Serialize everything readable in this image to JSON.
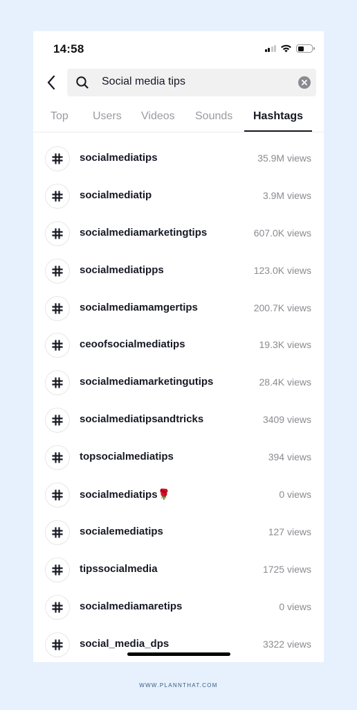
{
  "status_bar": {
    "time": "14:58",
    "signal_bars_active": 2,
    "signal_bars_total": 4,
    "battery_level": 0.45,
    "icons": [
      "cellular-signal-icon",
      "wifi-icon",
      "battery-icon"
    ]
  },
  "search": {
    "back_icon": "chevron-left-icon",
    "search_icon": "magnifier-icon",
    "query": "Social media tips",
    "clear_icon": "clear-x-icon"
  },
  "tabs": [
    {
      "label": "Top",
      "active": false
    },
    {
      "label": "Users",
      "active": false
    },
    {
      "label": "Videos",
      "active": false
    },
    {
      "label": "Sounds",
      "active": false
    },
    {
      "label": "Hashtags",
      "active": true
    }
  ],
  "hashtags": [
    {
      "name": "socialmediatips",
      "views": "35.9M views"
    },
    {
      "name": "socialmediatip",
      "views": "3.9M views"
    },
    {
      "name": "socialmediamarketingtips",
      "views": "607.0K views"
    },
    {
      "name": "socialmediatipps",
      "views": "123.0K views"
    },
    {
      "name": "socialmediamamgertips",
      "views": "200.7K views"
    },
    {
      "name": "ceoofsocialmediatips",
      "views": "19.3K views"
    },
    {
      "name": "socialmediamarketingutips",
      "views": "28.4K views"
    },
    {
      "name": "socialmediatipsandtricks",
      "views": "3409 views"
    },
    {
      "name": "topsocialmediatips",
      "views": "394 views"
    },
    {
      "name": "socialmediatips🌹",
      "views": "0 views"
    },
    {
      "name": "socialemediatips",
      "views": "127 views"
    },
    {
      "name": "tipssocialmedia",
      "views": "1725 views"
    },
    {
      "name": "socialmediamaretips",
      "views": "0 views"
    },
    {
      "name": "social_media_dps",
      "views": "3322 views"
    }
  ],
  "hash_symbol": "#",
  "footer": {
    "text": "WWW.PLANNTHAT.COM"
  },
  "colors": {
    "background": "#e6f1fd",
    "primary_text": "#161823",
    "secondary_text": "#8a8b91",
    "search_bg": "#f1f1f2"
  }
}
